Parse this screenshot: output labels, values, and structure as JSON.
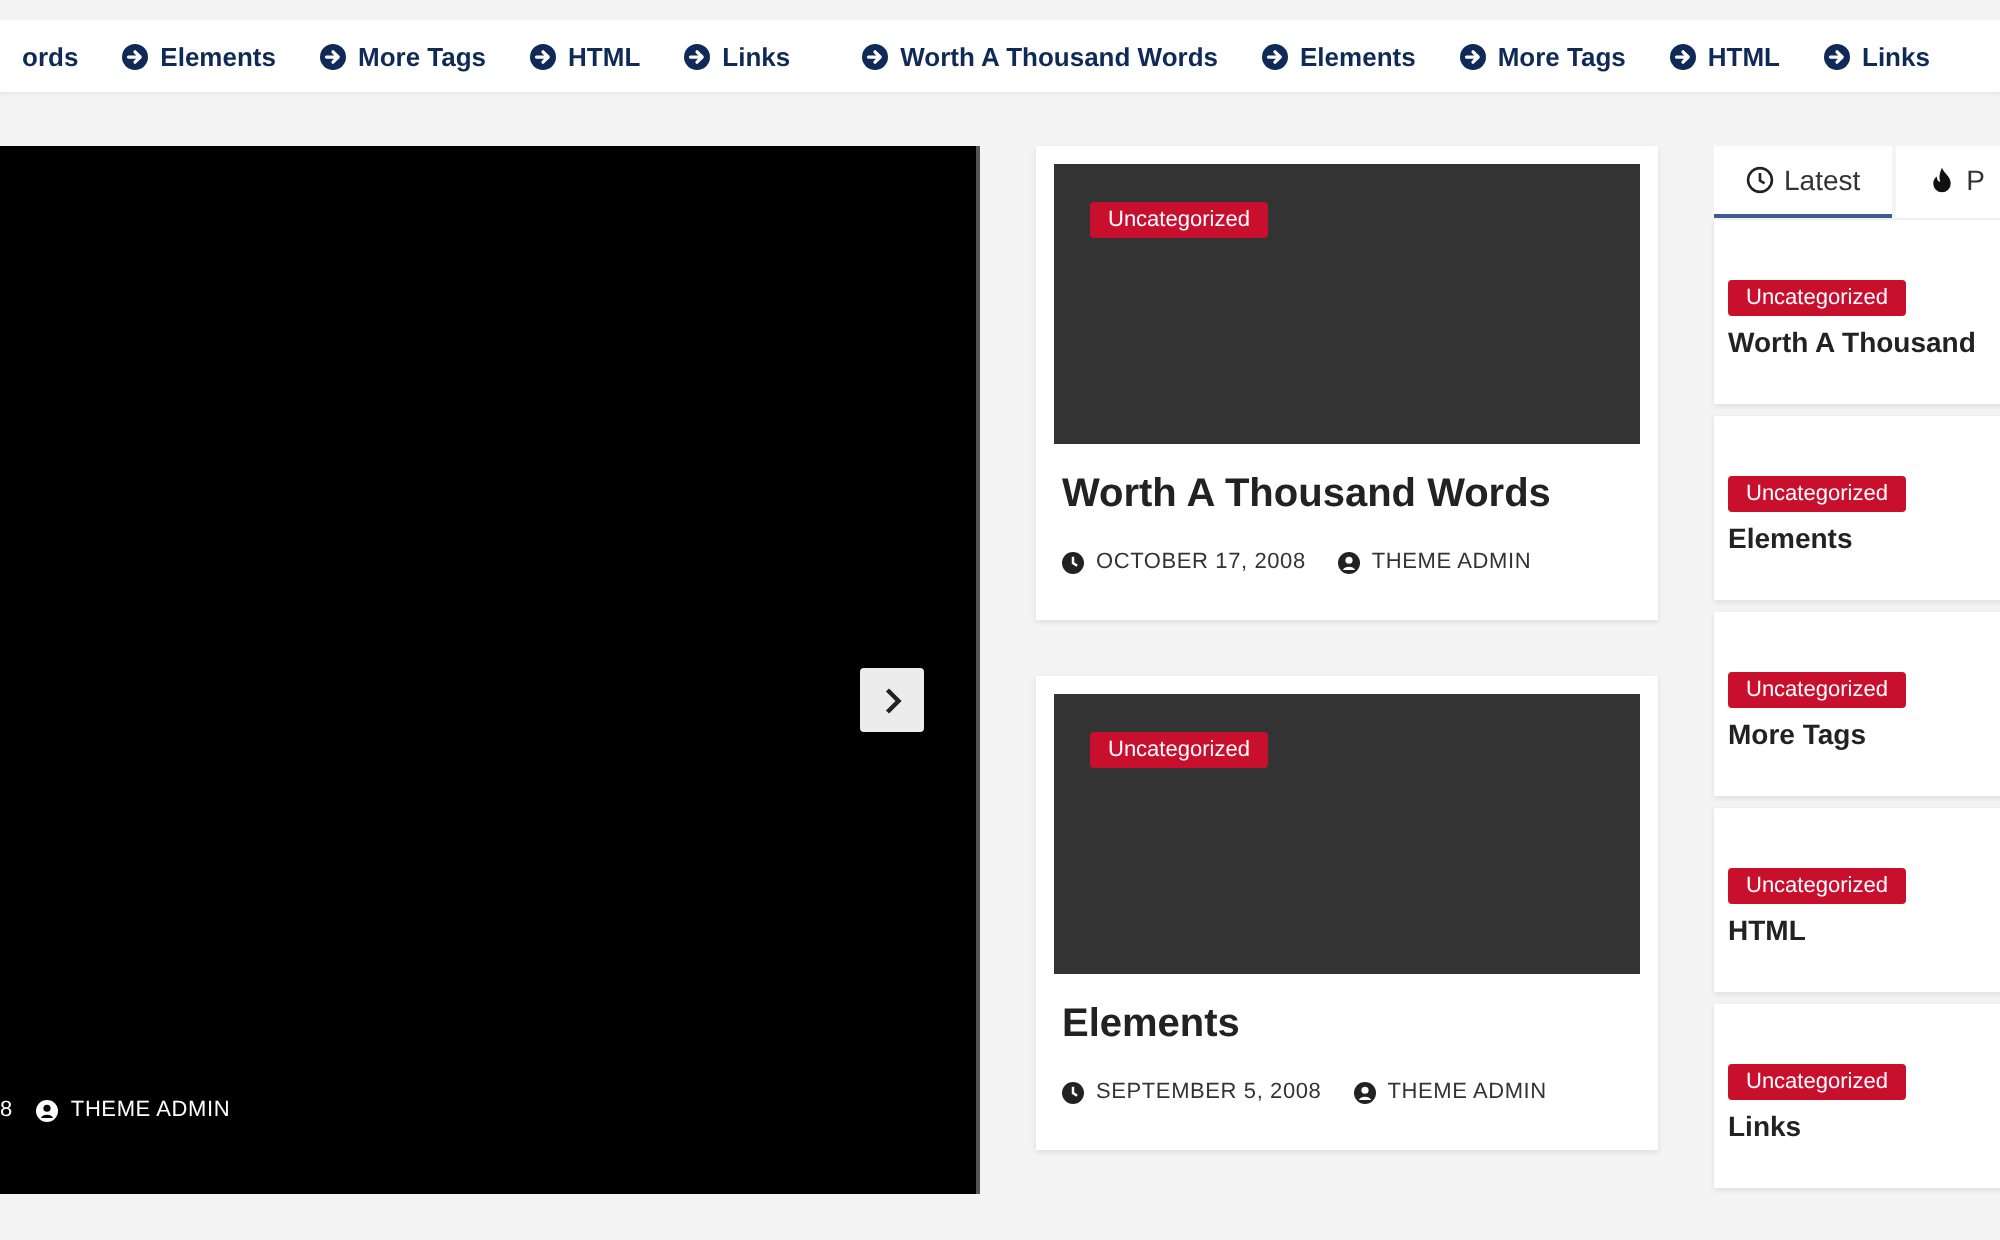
{
  "ticker": [
    {
      "label": "ords"
    },
    {
      "label": "Elements"
    },
    {
      "label": "More Tags"
    },
    {
      "label": "HTML"
    },
    {
      "label": "Links"
    },
    {
      "label": "Worth A Thousand Words"
    },
    {
      "label": "Elements"
    },
    {
      "label": "More Tags"
    },
    {
      "label": "HTML"
    },
    {
      "label": "Links"
    }
  ],
  "slider": {
    "date": "8",
    "author": "THEME ADMIN"
  },
  "posts": [
    {
      "category": "Uncategorized",
      "title": "Worth A Thousand Words",
      "date": "OCTOBER 17, 2008",
      "author": "THEME ADMIN"
    },
    {
      "category": "Uncategorized",
      "title": "Elements",
      "date": "SEPTEMBER 5, 2008",
      "author": "THEME ADMIN"
    }
  ],
  "sidebar": {
    "tabs": [
      {
        "label": "Latest",
        "selected": true
      },
      {
        "label": "P",
        "selected": false
      }
    ],
    "items": [
      {
        "category": "Uncategorized",
        "title": "Worth A Thousand"
      },
      {
        "category": "Uncategorized",
        "title": "Elements"
      },
      {
        "category": "Uncategorized",
        "title": "More Tags"
      },
      {
        "category": "Uncategorized",
        "title": "HTML"
      },
      {
        "category": "Uncategorized",
        "title": "Links"
      }
    ]
  }
}
